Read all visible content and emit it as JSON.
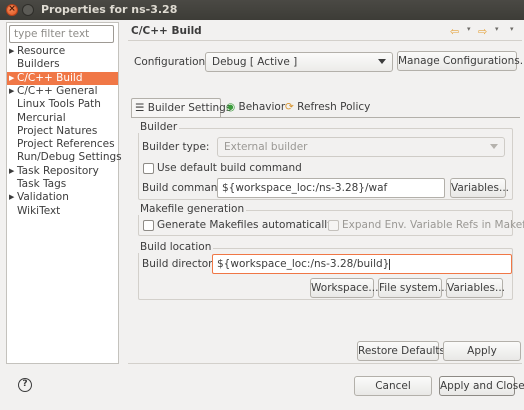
{
  "window": {
    "title": "Properties for ns-3.28",
    "close_glyph": "×"
  },
  "filter": {
    "placeholder": "type filter text"
  },
  "tree": [
    {
      "label": "Resource",
      "expandable": true,
      "selected": false
    },
    {
      "label": "Builders",
      "expandable": false,
      "selected": false
    },
    {
      "label": "C/C++ Build",
      "expandable": true,
      "selected": true
    },
    {
      "label": "C/C++ General",
      "expandable": true,
      "selected": false
    },
    {
      "label": "Linux Tools Path",
      "expandable": false,
      "selected": false
    },
    {
      "label": "Mercurial",
      "expandable": false,
      "selected": false
    },
    {
      "label": "Project Natures",
      "expandable": false,
      "selected": false
    },
    {
      "label": "Project References",
      "expandable": false,
      "selected": false
    },
    {
      "label": "Run/Debug Settings",
      "expandable": false,
      "selected": false
    },
    {
      "label": "Task Repository",
      "expandable": true,
      "selected": false
    },
    {
      "label": "Task Tags",
      "expandable": false,
      "selected": false
    },
    {
      "label": "Validation",
      "expandable": true,
      "selected": false
    },
    {
      "label": "WikiText",
      "expandable": false,
      "selected": false
    }
  ],
  "page": {
    "heading": "C/C++ Build",
    "nav": {
      "back": "⇦",
      "forward": "⇨",
      "menu": "▾"
    },
    "configuration": {
      "label": "Configuration:",
      "value": "Debug  [ Active ]",
      "manage_button": "Manage Configurations..."
    },
    "tabs": [
      {
        "label": "Builder Settings",
        "icon": "☰",
        "active": true
      },
      {
        "label": "Behavior",
        "icon": "◉",
        "active": false
      },
      {
        "label": "Refresh Policy",
        "icon": "⟳",
        "active": false
      }
    ],
    "builder": {
      "title": "Builder",
      "type_label": "Builder type:",
      "type_value": "External builder",
      "use_default_label": "Use default build command",
      "use_default_checked": false,
      "command_label": "Build command:",
      "command_value": "${workspace_loc:/ns-3.28}/waf",
      "variables_button": "Variables..."
    },
    "makefile": {
      "title": "Makefile generation",
      "generate_label": "Generate Makefiles automatically",
      "generate_checked": false,
      "expand_label": "Expand Env. Variable Refs in Makefiles",
      "expand_checked": false
    },
    "location": {
      "title": "Build location",
      "directory_label": "Build directory:",
      "directory_value": "${workspace_loc:/ns-3.28/build}",
      "workspace_button": "Workspace...",
      "filesystem_button": "File system...",
      "variables_button": "Variables..."
    },
    "restore_defaults_button": "Restore Defaults",
    "apply_button": "Apply"
  },
  "footer": {
    "help_glyph": "?",
    "cancel_button": "Cancel",
    "apply_close_button": "Apply and Close"
  },
  "colors": {
    "selection": "#f07746",
    "titlebar": "#3d3c37",
    "window_bg": "#f2f1f0",
    "nav_arrow": "#e5a33c"
  }
}
